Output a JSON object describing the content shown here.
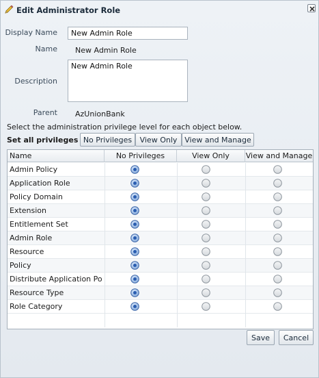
{
  "dialog": {
    "title": "Edit Administrator Role",
    "title_icon": "pencil-icon",
    "close_icon": "close-icon"
  },
  "form": {
    "display_name_label": "Display Name",
    "display_name_value": "New Admin Role",
    "name_label": "Name",
    "name_value": "New Admin Role",
    "description_label": "Description",
    "description_value": "New Admin Role",
    "parent_label": "Parent",
    "parent_value": "AzUnionBank"
  },
  "privileges": {
    "instruction": "Select the administration privilege level for each object below.",
    "set_all_label": "Set all privileges to",
    "set_all_buttons": [
      "No Privileges",
      "View Only",
      "View and Manage"
    ],
    "columns": [
      "Name",
      "No Privileges",
      "View Only",
      "View and Manage"
    ],
    "rows": [
      {
        "name": "Admin Policy",
        "selected": "No Privileges"
      },
      {
        "name": "Application Role",
        "selected": "No Privileges"
      },
      {
        "name": "Policy Domain",
        "selected": "No Privileges"
      },
      {
        "name": "Extension",
        "selected": "No Privileges"
      },
      {
        "name": "Entitlement Set",
        "selected": "No Privileges"
      },
      {
        "name": "Admin Role",
        "selected": "No Privileges"
      },
      {
        "name": "Resource",
        "selected": "No Privileges"
      },
      {
        "name": "Policy",
        "selected": "No Privileges"
      },
      {
        "name": "Distribute Application Policy",
        "selected": "No Privileges"
      },
      {
        "name": "Resource Type",
        "selected": "No Privileges"
      },
      {
        "name": "Role Category",
        "selected": "No Privileges"
      }
    ]
  },
  "footer": {
    "save_label": "Save",
    "cancel_label": "Cancel"
  },
  "colors": {
    "radio_selected": "#2a5db0",
    "header_text": "#1b2b3a"
  }
}
